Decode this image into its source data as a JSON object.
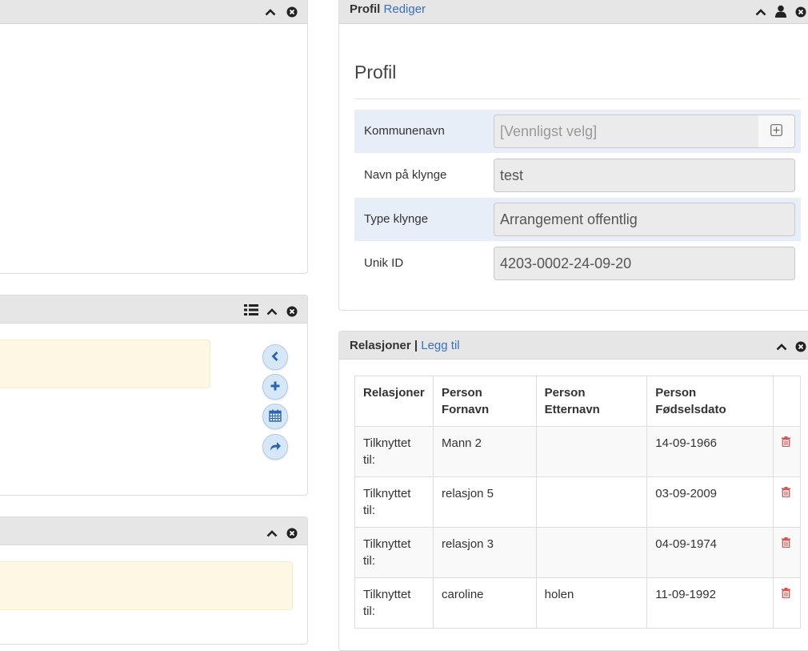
{
  "profile_panel": {
    "title": "Profil",
    "edit_link": "Rediger",
    "heading": "Profil",
    "fields": [
      {
        "label": "Kommunenavn",
        "value": "[Vennligst velg]"
      },
      {
        "label": "Navn på klynge",
        "value": "test"
      },
      {
        "label": "Type klynge",
        "value": "Arrangement offentlig"
      },
      {
        "label": "Unik ID",
        "value": "4203-0002-24-09-20"
      }
    ]
  },
  "relations_panel": {
    "title": "Relasjoner",
    "separator": "|",
    "add_link": "Legg til",
    "columns": [
      "Relasjoner",
      "Person Fornavn",
      "Person Etternavn",
      "Person Fødselsdato"
    ],
    "rows": [
      {
        "relation": "Tilknyttet til:",
        "first_name": "Mann 2",
        "last_name": "",
        "birth_date": "14-09-1966"
      },
      {
        "relation": "Tilknyttet til:",
        "first_name": "relasjon 5",
        "last_name": "",
        "birth_date": "03-09-2009"
      },
      {
        "relation": "Tilknyttet til:",
        "first_name": "relasjon 3",
        "last_name": "",
        "birth_date": "04-09-1974"
      },
      {
        "relation": "Tilknyttet til:",
        "first_name": "caroline",
        "last_name": "holen",
        "birth_date": "11-09-1992"
      }
    ]
  },
  "icons": {
    "collapse": "chevron-up-icon",
    "close": "close-circle-icon",
    "user": "user-icon",
    "list": "list-icon",
    "back": "chevron-left-icon",
    "add": "plus-icon",
    "calendar": "calendar-icon",
    "share": "share-icon",
    "delete": "trash-icon",
    "plus_box": "plus-square-icon"
  },
  "colors": {
    "link": "#3a6fbb",
    "panel_header": "#e6e6e6",
    "alt_row": "#e8eef7",
    "warning_bg": "#fcf8e3",
    "delete": "#d9534f"
  }
}
